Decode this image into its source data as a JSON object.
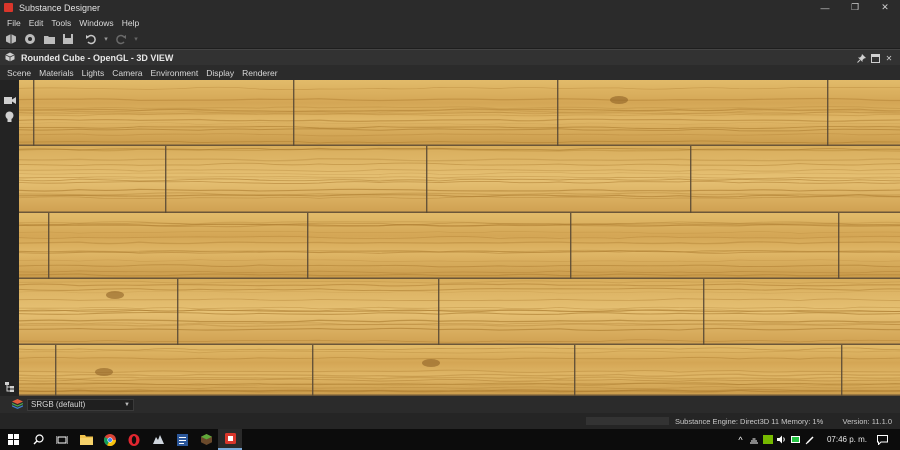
{
  "window": {
    "title": "Substance Designer",
    "minimize": "—",
    "maximize": "❐",
    "close": "✕"
  },
  "menu": [
    "File",
    "Edit",
    "Tools",
    "Windows",
    "Help"
  ],
  "toolbar": {
    "icons": [
      "new-graph-icon",
      "new-substance-icon",
      "open-icon",
      "save-all-icon",
      "undo-icon",
      "redo-icon"
    ]
  },
  "view": {
    "title": "Rounded Cube - OpenGL - 3D VIEW",
    "menu": [
      "Scene",
      "Materials",
      "Lights",
      "Camera",
      "Environment",
      "Display",
      "Renderer"
    ]
  },
  "footer": {
    "color_space": "SRGB (default)"
  },
  "status": {
    "engine": "Substance Engine: Direct3D 11  Memory: 1%",
    "version": "Version: 11.1.0"
  },
  "taskbar": {
    "clock": "07:46 p. m.",
    "apps": [
      "windows-start",
      "search",
      "task-view",
      "file-explorer",
      "chrome",
      "opera",
      "steam",
      "word",
      "minecraft",
      "substance-designer"
    ]
  },
  "colors": {
    "wood": "#d6ad59",
    "wood_dark": "#a9782c",
    "seam": "#5a4a35",
    "accent": "#d9362b"
  }
}
